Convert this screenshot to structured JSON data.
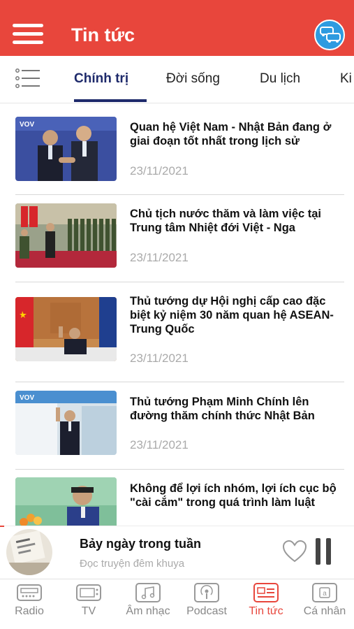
{
  "header": {
    "title": "Tin tức",
    "brand_color": "#e8463c",
    "menu_icon": "hamburger-menu-icon",
    "traffic_icon": "traffic-cars-icon"
  },
  "tabs": {
    "list_icon": "category-list-icon",
    "items": [
      {
        "label": "Chính trị",
        "active": true
      },
      {
        "label": "Đời sống",
        "active": false
      },
      {
        "label": "Du lịch",
        "active": false
      },
      {
        "label": "Ki",
        "active": false
      }
    ],
    "active_color": "#1e2a6b"
  },
  "news": [
    {
      "title": "Quan hệ Việt Nam - Nhật Bản đang ở giai đoạn tốt nhất trong lịch sử",
      "date": "23/11/2021"
    },
    {
      "title": "Chủ tịch nước thăm và làm việc tại Trung tâm Nhiệt đới Việt - Nga",
      "date": "23/11/2021"
    },
    {
      "title": "Thủ tướng dự Hội nghị cấp cao đặc biệt kỷ niệm 30 năm quan hệ ASEAN-Trung Quốc",
      "date": "23/11/2021"
    },
    {
      "title": "Thủ tướng Phạm Minh Chính lên đường thăm chính thức Nhật Bản",
      "date": "23/11/2021"
    },
    {
      "title": "Không để lợi ích nhóm, lợi ích cục bộ \"cài cắm\" trong quá trình làm luật",
      "date": ""
    }
  ],
  "player": {
    "title": "Bảy ngày trong tuần",
    "subtitle": "Đọc truyện đêm khuya",
    "like_icon": "heart-outline-icon",
    "pause_icon": "pause-icon"
  },
  "bottom_nav": [
    {
      "label": "Radio",
      "icon": "radio-icon",
      "active": false
    },
    {
      "label": "TV",
      "icon": "tv-icon",
      "active": false
    },
    {
      "label": "Âm nhạc",
      "icon": "music-icon",
      "active": false
    },
    {
      "label": "Podcast",
      "icon": "podcast-icon",
      "active": false
    },
    {
      "label": "Tin tức",
      "icon": "news-icon",
      "active": true
    },
    {
      "label": "Cá nhân",
      "icon": "profile-icon",
      "active": false
    }
  ]
}
